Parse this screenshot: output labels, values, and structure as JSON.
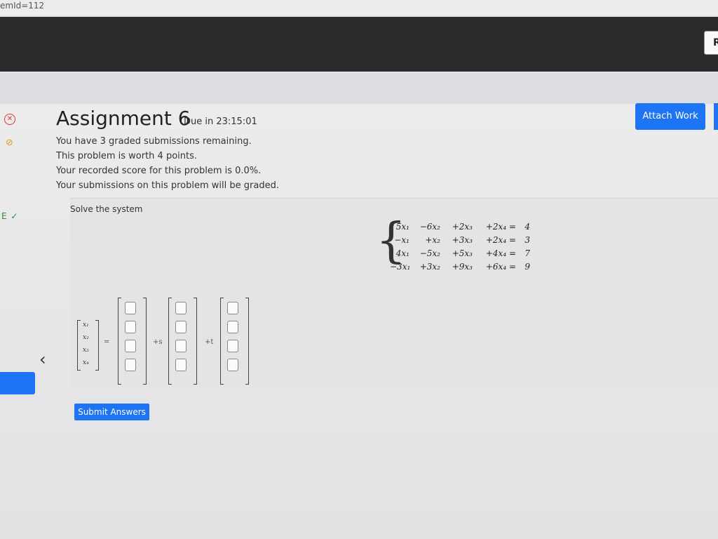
{
  "url_fragment": "emId=112",
  "topbar": {
    "right_button_label": "R"
  },
  "assignment": {
    "title": "Assignment 6",
    "due": "Due in 23:15:01",
    "info_lines": [
      "You have 3 graded submissions remaining.",
      "This problem is worth 4 points.",
      "Your recorded score for this problem is 0.0%.",
      "Your submissions on this problem will be graded."
    ]
  },
  "actions": {
    "attach_label": "Attach Work",
    "submit_label": "Submit Answers"
  },
  "sidebar": {
    "status_e_label": "E"
  },
  "problem": {
    "prompt": "Solve the system",
    "equations": [
      [
        "5x₁",
        "−6x₂",
        "+2x₃",
        "+2x₄ =",
        "4"
      ],
      [
        "−x₁",
        "+x₂",
        "+3x₃",
        "+2x₄ =",
        "3"
      ],
      [
        "4x₁",
        "−5x₂",
        "+5x₃",
        "+4x₄ =",
        "7"
      ],
      [
        "−3x₁",
        "+3x₂",
        "+9x₃",
        "+6x₄ =",
        "9"
      ]
    ],
    "unknowns": [
      "x₁",
      "x₂",
      "x₃",
      "x₄"
    ],
    "equals_sign": "=",
    "param_s": "+s",
    "param_t": "+t"
  }
}
